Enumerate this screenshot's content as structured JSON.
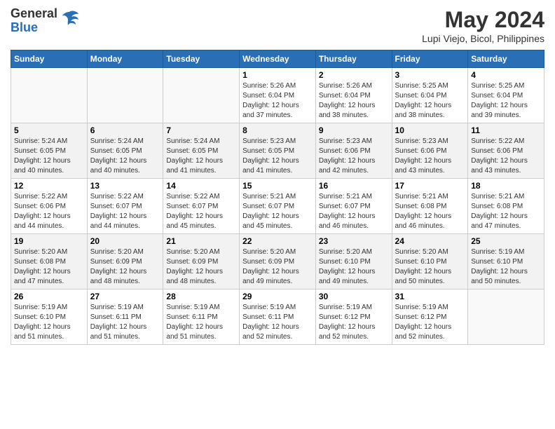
{
  "logo": {
    "general": "General",
    "blue": "Blue"
  },
  "title": "May 2024",
  "subtitle": "Lupi Viejo, Bicol, Philippines",
  "days_of_week": [
    "Sunday",
    "Monday",
    "Tuesday",
    "Wednesday",
    "Thursday",
    "Friday",
    "Saturday"
  ],
  "weeks": [
    [
      {
        "day": "",
        "info": ""
      },
      {
        "day": "",
        "info": ""
      },
      {
        "day": "",
        "info": ""
      },
      {
        "day": "1",
        "info": "Sunrise: 5:26 AM\nSunset: 6:04 PM\nDaylight: 12 hours\nand 37 minutes."
      },
      {
        "day": "2",
        "info": "Sunrise: 5:26 AM\nSunset: 6:04 PM\nDaylight: 12 hours\nand 38 minutes."
      },
      {
        "day": "3",
        "info": "Sunrise: 5:25 AM\nSunset: 6:04 PM\nDaylight: 12 hours\nand 38 minutes."
      },
      {
        "day": "4",
        "info": "Sunrise: 5:25 AM\nSunset: 6:04 PM\nDaylight: 12 hours\nand 39 minutes."
      }
    ],
    [
      {
        "day": "5",
        "info": "Sunrise: 5:24 AM\nSunset: 6:05 PM\nDaylight: 12 hours\nand 40 minutes."
      },
      {
        "day": "6",
        "info": "Sunrise: 5:24 AM\nSunset: 6:05 PM\nDaylight: 12 hours\nand 40 minutes."
      },
      {
        "day": "7",
        "info": "Sunrise: 5:24 AM\nSunset: 6:05 PM\nDaylight: 12 hours\nand 41 minutes."
      },
      {
        "day": "8",
        "info": "Sunrise: 5:23 AM\nSunset: 6:05 PM\nDaylight: 12 hours\nand 41 minutes."
      },
      {
        "day": "9",
        "info": "Sunrise: 5:23 AM\nSunset: 6:06 PM\nDaylight: 12 hours\nand 42 minutes."
      },
      {
        "day": "10",
        "info": "Sunrise: 5:23 AM\nSunset: 6:06 PM\nDaylight: 12 hours\nand 43 minutes."
      },
      {
        "day": "11",
        "info": "Sunrise: 5:22 AM\nSunset: 6:06 PM\nDaylight: 12 hours\nand 43 minutes."
      }
    ],
    [
      {
        "day": "12",
        "info": "Sunrise: 5:22 AM\nSunset: 6:06 PM\nDaylight: 12 hours\nand 44 minutes."
      },
      {
        "day": "13",
        "info": "Sunrise: 5:22 AM\nSunset: 6:07 PM\nDaylight: 12 hours\nand 44 minutes."
      },
      {
        "day": "14",
        "info": "Sunrise: 5:22 AM\nSunset: 6:07 PM\nDaylight: 12 hours\nand 45 minutes."
      },
      {
        "day": "15",
        "info": "Sunrise: 5:21 AM\nSunset: 6:07 PM\nDaylight: 12 hours\nand 45 minutes."
      },
      {
        "day": "16",
        "info": "Sunrise: 5:21 AM\nSunset: 6:07 PM\nDaylight: 12 hours\nand 46 minutes."
      },
      {
        "day": "17",
        "info": "Sunrise: 5:21 AM\nSunset: 6:08 PM\nDaylight: 12 hours\nand 46 minutes."
      },
      {
        "day": "18",
        "info": "Sunrise: 5:21 AM\nSunset: 6:08 PM\nDaylight: 12 hours\nand 47 minutes."
      }
    ],
    [
      {
        "day": "19",
        "info": "Sunrise: 5:20 AM\nSunset: 6:08 PM\nDaylight: 12 hours\nand 47 minutes."
      },
      {
        "day": "20",
        "info": "Sunrise: 5:20 AM\nSunset: 6:09 PM\nDaylight: 12 hours\nand 48 minutes."
      },
      {
        "day": "21",
        "info": "Sunrise: 5:20 AM\nSunset: 6:09 PM\nDaylight: 12 hours\nand 48 minutes."
      },
      {
        "day": "22",
        "info": "Sunrise: 5:20 AM\nSunset: 6:09 PM\nDaylight: 12 hours\nand 49 minutes."
      },
      {
        "day": "23",
        "info": "Sunrise: 5:20 AM\nSunset: 6:10 PM\nDaylight: 12 hours\nand 49 minutes."
      },
      {
        "day": "24",
        "info": "Sunrise: 5:20 AM\nSunset: 6:10 PM\nDaylight: 12 hours\nand 50 minutes."
      },
      {
        "day": "25",
        "info": "Sunrise: 5:19 AM\nSunset: 6:10 PM\nDaylight: 12 hours\nand 50 minutes."
      }
    ],
    [
      {
        "day": "26",
        "info": "Sunrise: 5:19 AM\nSunset: 6:10 PM\nDaylight: 12 hours\nand 51 minutes."
      },
      {
        "day": "27",
        "info": "Sunrise: 5:19 AM\nSunset: 6:11 PM\nDaylight: 12 hours\nand 51 minutes."
      },
      {
        "day": "28",
        "info": "Sunrise: 5:19 AM\nSunset: 6:11 PM\nDaylight: 12 hours\nand 51 minutes."
      },
      {
        "day": "29",
        "info": "Sunrise: 5:19 AM\nSunset: 6:11 PM\nDaylight: 12 hours\nand 52 minutes."
      },
      {
        "day": "30",
        "info": "Sunrise: 5:19 AM\nSunset: 6:12 PM\nDaylight: 12 hours\nand 52 minutes."
      },
      {
        "day": "31",
        "info": "Sunrise: 5:19 AM\nSunset: 6:12 PM\nDaylight: 12 hours\nand 52 minutes."
      },
      {
        "day": "",
        "info": ""
      }
    ]
  ]
}
